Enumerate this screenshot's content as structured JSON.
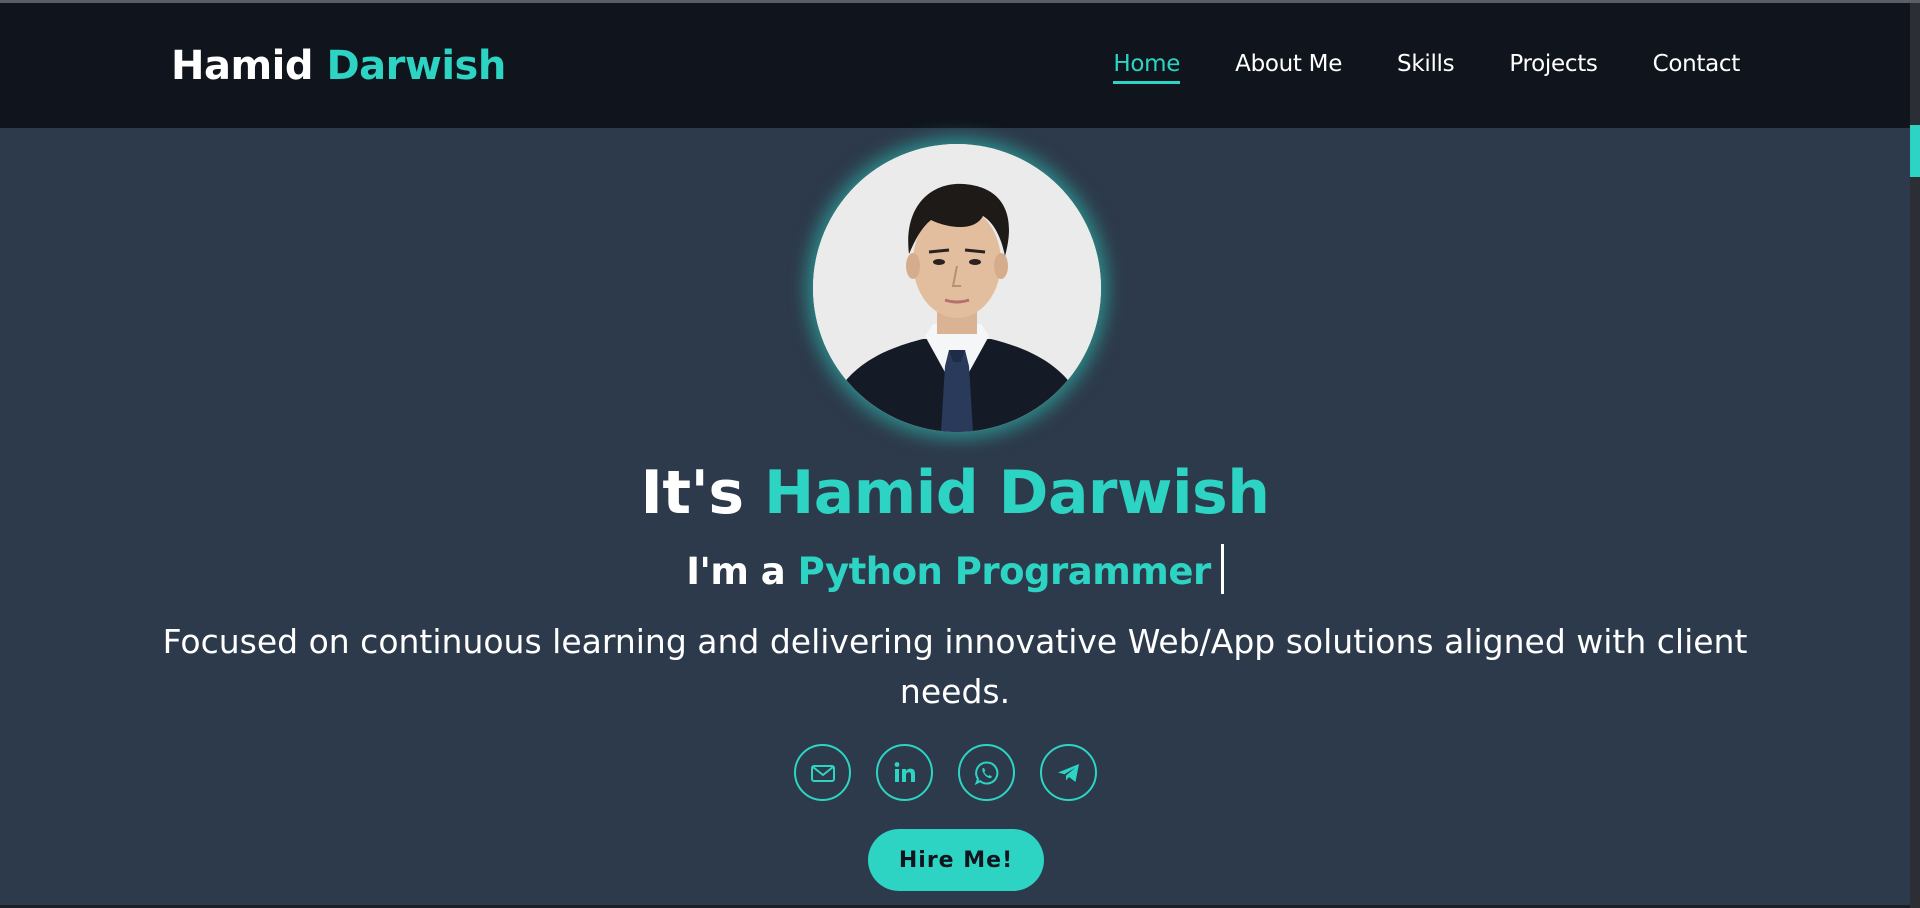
{
  "brand": {
    "first_name": "Hamid",
    "last_name": "Darwish"
  },
  "nav": {
    "items": [
      {
        "label": "Home",
        "active": true
      },
      {
        "label": "About Me",
        "active": false
      },
      {
        "label": "Skills",
        "active": false
      },
      {
        "label": "Projects",
        "active": false
      },
      {
        "label": "Contact",
        "active": false
      }
    ]
  },
  "hero": {
    "greeting": "It's",
    "name": "Hamid Darwish",
    "role_prefix": "I'm a",
    "role": "Python Programmer",
    "description": "Focused on continuous learning and delivering innovative Web/App solutions aligned with client needs.",
    "hire_label": "Hire Me!"
  },
  "socials": [
    {
      "icon": "mail-icon"
    },
    {
      "icon": "linkedin-icon"
    },
    {
      "icon": "whatsapp-icon"
    },
    {
      "icon": "telegram-icon"
    }
  ],
  "colors": {
    "accent": "#2dd4c3",
    "navbar_bg": "#10151d",
    "page_bg": "#2d3a4b"
  }
}
